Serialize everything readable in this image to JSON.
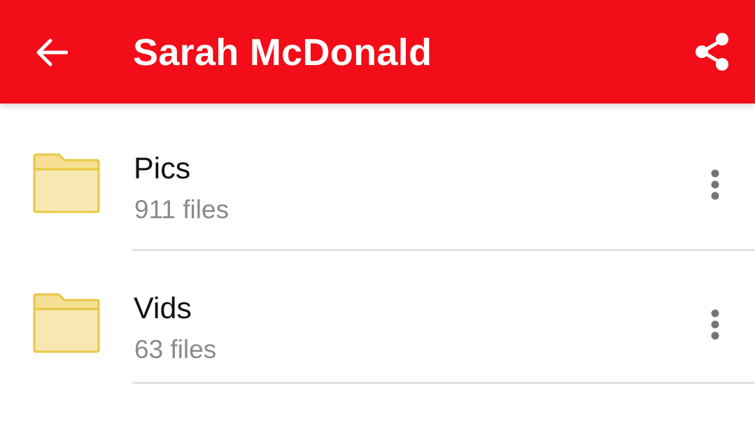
{
  "colors": {
    "app_bar": "#f20d18",
    "title_text": "#ffffff",
    "folder_fill": "#f9e7b1",
    "folder_stroke": "#e8c743",
    "name_text": "#111111",
    "count_text": "#8a8a8a",
    "more_icon": "#757575",
    "divider": "#e2e2e2"
  },
  "app_bar": {
    "back_icon": "arrow-left-icon",
    "title": "Sarah McDonald",
    "share_icon": "share-icon"
  },
  "list": {
    "items": [
      {
        "name": "Pics",
        "count": "911 files",
        "icon": "folder-icon",
        "menu_icon": "more-vert-icon"
      },
      {
        "name": "Vids",
        "count": "63 files",
        "icon": "folder-icon",
        "menu_icon": "more-vert-icon"
      }
    ]
  }
}
